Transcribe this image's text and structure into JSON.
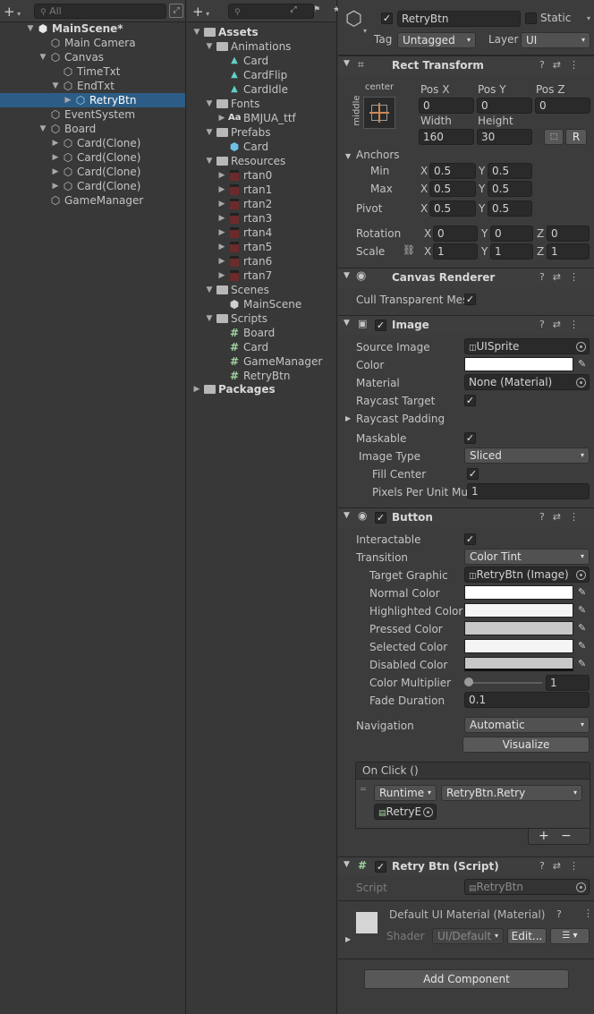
{
  "hierarchy": {
    "search_placeholder": "All",
    "items": [
      {
        "label": "MainScene*",
        "bold": true
      },
      {
        "label": "Main Camera"
      },
      {
        "label": "Canvas"
      },
      {
        "label": "TimeTxt"
      },
      {
        "label": "EndTxt"
      },
      {
        "label": "RetryBtn",
        "selected": true
      },
      {
        "label": "EventSystem"
      },
      {
        "label": "Board"
      },
      {
        "label": "Card(Clone)"
      },
      {
        "label": "Card(Clone)"
      },
      {
        "label": "Card(Clone)"
      },
      {
        "label": "Card(Clone)"
      },
      {
        "label": "GameManager"
      }
    ]
  },
  "project": {
    "items": [
      {
        "label": "Assets",
        "bold": true
      },
      {
        "label": "Animations"
      },
      {
        "label": "Card"
      },
      {
        "label": "CardFlip"
      },
      {
        "label": "CardIdle"
      },
      {
        "label": "Fonts"
      },
      {
        "label": "BMJUA_ttf",
        "icon_text": "Aa"
      },
      {
        "label": "Prefabs"
      },
      {
        "label": "Card"
      },
      {
        "label": "Resources"
      },
      {
        "label": "rtan0"
      },
      {
        "label": "rtan1"
      },
      {
        "label": "rtan2"
      },
      {
        "label": "rtan3"
      },
      {
        "label": "rtan4"
      },
      {
        "label": "rtan5"
      },
      {
        "label": "rtan6"
      },
      {
        "label": "rtan7"
      },
      {
        "label": "Scenes"
      },
      {
        "label": "MainScene"
      },
      {
        "label": "Scripts"
      },
      {
        "label": "Board"
      },
      {
        "label": "Card"
      },
      {
        "label": "GameManager"
      },
      {
        "label": "RetryBtn"
      },
      {
        "label": "Packages",
        "bold": true
      }
    ]
  },
  "inspector": {
    "object_name": "RetryBtn",
    "static_label": "Static",
    "tag_label": "Tag",
    "tag_value": "Untagged",
    "layer_label": "Layer",
    "layer_value": "UI",
    "rect_transform": {
      "title": "Rect Transform",
      "anchor_h": "center",
      "anchor_v": "middle",
      "pos_x_label": "Pos X",
      "pos_y_label": "Pos Y",
      "pos_z_label": "Pos Z",
      "pos_x": "0",
      "pos_y": "0",
      "pos_z": "0",
      "width_label": "Width",
      "height_label": "Height",
      "width": "160",
      "height": "30",
      "r_label": "R",
      "anchors_label": "Anchors",
      "min_label": "Min",
      "max_label": "Max",
      "pivot_label": "Pivot",
      "x_label": "X",
      "y_label": "Y",
      "z_label": "Z",
      "min_x": "0.5",
      "min_y": "0.5",
      "max_x": "0.5",
      "max_y": "0.5",
      "pivot_x": "0.5",
      "pivot_y": "0.5",
      "rotation_label": "Rotation",
      "rot_x": "0",
      "rot_y": "0",
      "rot_z": "0",
      "scale_label": "Scale",
      "scale_x": "1",
      "scale_y": "1",
      "scale_z": "1"
    },
    "canvas_renderer": {
      "title": "Canvas Renderer",
      "cull_label": "Cull Transparent Mes"
    },
    "image": {
      "title": "Image",
      "source_label": "Source Image",
      "source_value": "UISprite",
      "color_label": "Color",
      "material_label": "Material",
      "material_value": "None (Material)",
      "raycast_target_label": "Raycast Target",
      "raycast_padding_label": "Raycast Padding",
      "maskable_label": "Maskable",
      "image_type_label": "Image Type",
      "image_type_value": "Sliced",
      "fill_center_label": "Fill Center",
      "ppu_label": "Pixels Per Unit Mul",
      "ppu_value": "1"
    },
    "button": {
      "title": "Button",
      "interactable_label": "Interactable",
      "transition_label": "Transition",
      "transition_value": "Color Tint",
      "target_graphic_label": "Target Graphic",
      "target_graphic_value": "RetryBtn (Image)",
      "normal_label": "Normal Color",
      "highlighted_label": "Highlighted Color",
      "pressed_label": "Pressed Color",
      "selected_label": "Selected Color",
      "disabled_label": "Disabled Color",
      "multiplier_label": "Color Multiplier",
      "multiplier_value": "1",
      "fade_label": "Fade Duration",
      "fade_value": "0.1",
      "navigation_label": "Navigation",
      "navigation_value": "Automatic",
      "visualize_label": "Visualize",
      "onclick_label": "On Click ()",
      "runtime_value": "Runtime",
      "function_value": "RetryBtn.Retry",
      "object_value": "RetryE",
      "plus_label": "+",
      "minus_label": "−"
    },
    "retry_script": {
      "title": "Retry Btn (Script)",
      "script_label": "Script",
      "script_value": "RetryBtn"
    },
    "material": {
      "title": "Default UI Material (Material)",
      "shader_label": "Shader",
      "shader_value": "UI/Default",
      "edit_label": "Edit..."
    },
    "add_component_label": "Add Component"
  },
  "colors": {
    "selection": "#2c5d87",
    "panel": "#383838",
    "inspector": "#3c3c3c",
    "pressed_color": "#c8c8c8",
    "disabled_color": "#c8c8c8",
    "highlighted_color": "#f5f5f5",
    "selected_color": "#f5f5f5"
  }
}
